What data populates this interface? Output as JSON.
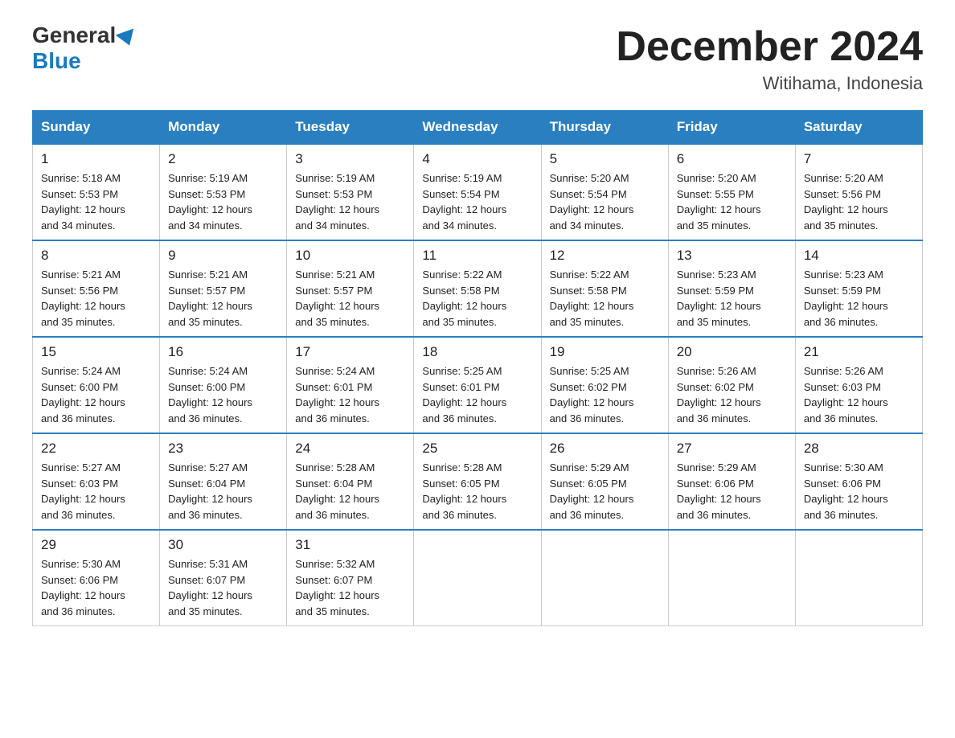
{
  "header": {
    "logo": {
      "general": "General",
      "blue": "Blue"
    },
    "title": "December 2024",
    "location": "Witihama, Indonesia"
  },
  "days_of_week": [
    "Sunday",
    "Monday",
    "Tuesday",
    "Wednesday",
    "Thursday",
    "Friday",
    "Saturday"
  ],
  "weeks": [
    [
      {
        "day": "1",
        "sunrise": "5:18 AM",
        "sunset": "5:53 PM",
        "daylight": "12 hours and 34 minutes."
      },
      {
        "day": "2",
        "sunrise": "5:19 AM",
        "sunset": "5:53 PM",
        "daylight": "12 hours and 34 minutes."
      },
      {
        "day": "3",
        "sunrise": "5:19 AM",
        "sunset": "5:53 PM",
        "daylight": "12 hours and 34 minutes."
      },
      {
        "day": "4",
        "sunrise": "5:19 AM",
        "sunset": "5:54 PM",
        "daylight": "12 hours and 34 minutes."
      },
      {
        "day": "5",
        "sunrise": "5:20 AM",
        "sunset": "5:54 PM",
        "daylight": "12 hours and 34 minutes."
      },
      {
        "day": "6",
        "sunrise": "5:20 AM",
        "sunset": "5:55 PM",
        "daylight": "12 hours and 35 minutes."
      },
      {
        "day": "7",
        "sunrise": "5:20 AM",
        "sunset": "5:56 PM",
        "daylight": "12 hours and 35 minutes."
      }
    ],
    [
      {
        "day": "8",
        "sunrise": "5:21 AM",
        "sunset": "5:56 PM",
        "daylight": "12 hours and 35 minutes."
      },
      {
        "day": "9",
        "sunrise": "5:21 AM",
        "sunset": "5:57 PM",
        "daylight": "12 hours and 35 minutes."
      },
      {
        "day": "10",
        "sunrise": "5:21 AM",
        "sunset": "5:57 PM",
        "daylight": "12 hours and 35 minutes."
      },
      {
        "day": "11",
        "sunrise": "5:22 AM",
        "sunset": "5:58 PM",
        "daylight": "12 hours and 35 minutes."
      },
      {
        "day": "12",
        "sunrise": "5:22 AM",
        "sunset": "5:58 PM",
        "daylight": "12 hours and 35 minutes."
      },
      {
        "day": "13",
        "sunrise": "5:23 AM",
        "sunset": "5:59 PM",
        "daylight": "12 hours and 35 minutes."
      },
      {
        "day": "14",
        "sunrise": "5:23 AM",
        "sunset": "5:59 PM",
        "daylight": "12 hours and 36 minutes."
      }
    ],
    [
      {
        "day": "15",
        "sunrise": "5:24 AM",
        "sunset": "6:00 PM",
        "daylight": "12 hours and 36 minutes."
      },
      {
        "day": "16",
        "sunrise": "5:24 AM",
        "sunset": "6:00 PM",
        "daylight": "12 hours and 36 minutes."
      },
      {
        "day": "17",
        "sunrise": "5:24 AM",
        "sunset": "6:01 PM",
        "daylight": "12 hours and 36 minutes."
      },
      {
        "day": "18",
        "sunrise": "5:25 AM",
        "sunset": "6:01 PM",
        "daylight": "12 hours and 36 minutes."
      },
      {
        "day": "19",
        "sunrise": "5:25 AM",
        "sunset": "6:02 PM",
        "daylight": "12 hours and 36 minutes."
      },
      {
        "day": "20",
        "sunrise": "5:26 AM",
        "sunset": "6:02 PM",
        "daylight": "12 hours and 36 minutes."
      },
      {
        "day": "21",
        "sunrise": "5:26 AM",
        "sunset": "6:03 PM",
        "daylight": "12 hours and 36 minutes."
      }
    ],
    [
      {
        "day": "22",
        "sunrise": "5:27 AM",
        "sunset": "6:03 PM",
        "daylight": "12 hours and 36 minutes."
      },
      {
        "day": "23",
        "sunrise": "5:27 AM",
        "sunset": "6:04 PM",
        "daylight": "12 hours and 36 minutes."
      },
      {
        "day": "24",
        "sunrise": "5:28 AM",
        "sunset": "6:04 PM",
        "daylight": "12 hours and 36 minutes."
      },
      {
        "day": "25",
        "sunrise": "5:28 AM",
        "sunset": "6:05 PM",
        "daylight": "12 hours and 36 minutes."
      },
      {
        "day": "26",
        "sunrise": "5:29 AM",
        "sunset": "6:05 PM",
        "daylight": "12 hours and 36 minutes."
      },
      {
        "day": "27",
        "sunrise": "5:29 AM",
        "sunset": "6:06 PM",
        "daylight": "12 hours and 36 minutes."
      },
      {
        "day": "28",
        "sunrise": "5:30 AM",
        "sunset": "6:06 PM",
        "daylight": "12 hours and 36 minutes."
      }
    ],
    [
      {
        "day": "29",
        "sunrise": "5:30 AM",
        "sunset": "6:06 PM",
        "daylight": "12 hours and 36 minutes."
      },
      {
        "day": "30",
        "sunrise": "5:31 AM",
        "sunset": "6:07 PM",
        "daylight": "12 hours and 35 minutes."
      },
      {
        "day": "31",
        "sunrise": "5:32 AM",
        "sunset": "6:07 PM",
        "daylight": "12 hours and 35 minutes."
      },
      null,
      null,
      null,
      null
    ]
  ],
  "labels": {
    "sunrise_prefix": "Sunrise: ",
    "sunset_prefix": "Sunset: ",
    "daylight_prefix": "Daylight: "
  }
}
